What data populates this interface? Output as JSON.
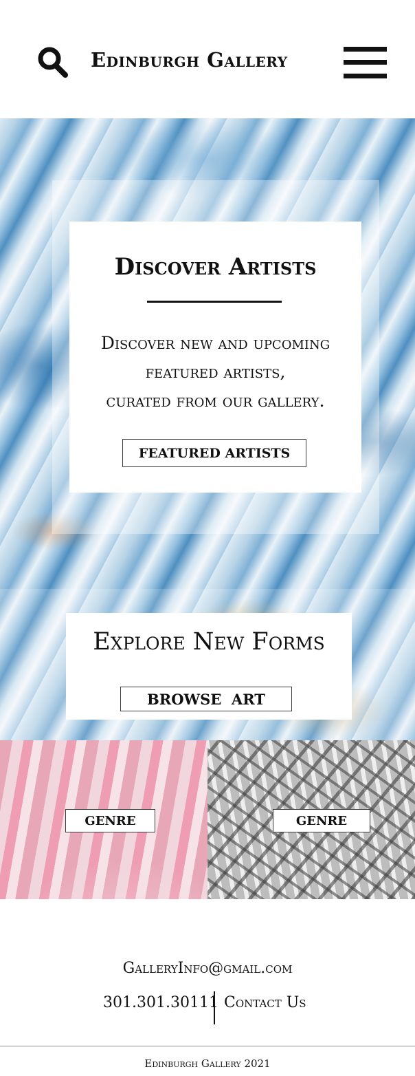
{
  "header": {
    "brand": "Edinburgh Gallery",
    "search_icon": "search-icon",
    "menu_icon": "hamburger-menu-icon"
  },
  "hero": {
    "title": "Discover Artists",
    "description_lines": [
      "Discover new and upcoming",
      "featured artists,",
      "curated from our gallery."
    ],
    "button_label": "FEATURED ARTISTS"
  },
  "explore": {
    "title": "Explore New Forms",
    "button_label": "BROWSE  ART"
  },
  "genres": [
    {
      "label": "GENRE"
    },
    {
      "label": "GENRE"
    }
  ],
  "footer": {
    "email": "GalleryInfo@gmail.com",
    "phone": "301.301.30111",
    "contact": "Contact Us",
    "copyright": "Edinburgh Gallery 2021"
  },
  "colors": {
    "text": "#111111",
    "background": "#ffffff",
    "marble_blue": "#7fb0d5",
    "genre_pink": "#e8a7b7",
    "genre_grey": "#bdbdbd"
  }
}
